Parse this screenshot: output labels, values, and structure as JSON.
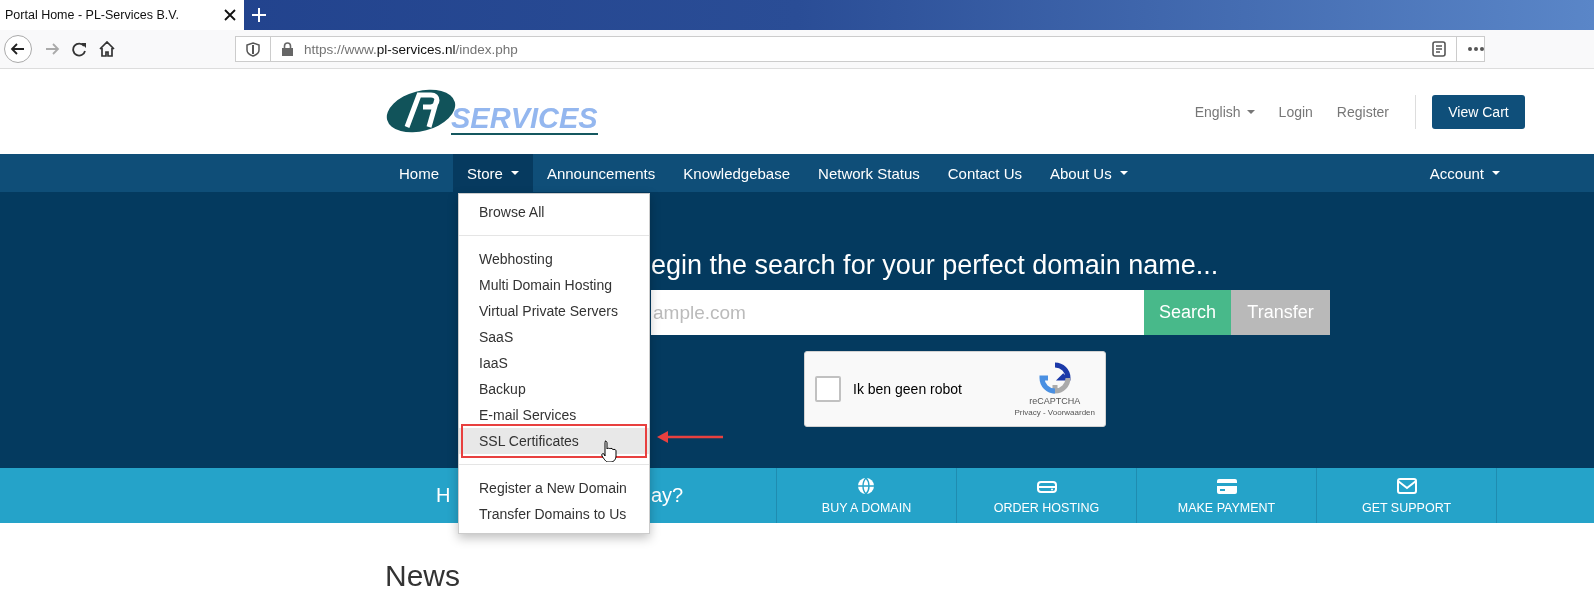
{
  "browser": {
    "tab_title": "Portal Home - PL-Services B.V.",
    "url": {
      "prefix": "https://www.",
      "domain": "pl-services.nl",
      "path": "/index.php"
    }
  },
  "header": {
    "logo_text": "SERVICES",
    "links": [
      {
        "label": "English",
        "dropdown": true
      },
      {
        "label": "Login",
        "dropdown": false
      },
      {
        "label": "Register",
        "dropdown": false
      }
    ],
    "cart_button": "View Cart"
  },
  "nav": {
    "items": [
      {
        "label": "Home",
        "selected": false,
        "dropdown": false
      },
      {
        "label": "Store",
        "selected": true,
        "dropdown": true
      },
      {
        "label": "Announcements",
        "selected": false,
        "dropdown": false
      },
      {
        "label": "Knowledgebase",
        "selected": false,
        "dropdown": false
      },
      {
        "label": "Network Status",
        "selected": false,
        "dropdown": false
      },
      {
        "label": "Contact Us",
        "selected": false,
        "dropdown": false
      },
      {
        "label": "About Us",
        "selected": false,
        "dropdown": true
      }
    ],
    "account": {
      "label": "Account",
      "dropdown": true
    }
  },
  "store_menu": {
    "sections": [
      {
        "items": [
          {
            "label": "Browse All",
            "selected": false,
            "highlighted": false
          }
        ]
      },
      {
        "items": [
          {
            "label": "Webhosting",
            "selected": false,
            "highlighted": false
          },
          {
            "label": "Multi Domain Hosting",
            "selected": false,
            "highlighted": false
          },
          {
            "label": "Virtual Private Servers",
            "selected": false,
            "highlighted": false
          },
          {
            "label": "SaaS",
            "selected": false,
            "highlighted": false
          },
          {
            "label": "IaaS",
            "selected": false,
            "highlighted": false
          },
          {
            "label": "Backup",
            "selected": false,
            "highlighted": false
          },
          {
            "label": "E-mail Services",
            "selected": false,
            "highlighted": false
          },
          {
            "label": "SSL Certificates",
            "selected": true,
            "highlighted": true
          }
        ]
      },
      {
        "items": [
          {
            "label": "Register a New Domain",
            "selected": false,
            "highlighted": false
          },
          {
            "label": "Transfer Domains to Us",
            "selected": false,
            "highlighted": false
          }
        ]
      }
    ]
  },
  "hero": {
    "heading": "egin the search for your perfect domain name...",
    "search": {
      "placeholder": "ample.com"
    },
    "buttons": [
      "Search",
      "Transfer"
    ],
    "captcha": {
      "checked": false,
      "label": "Ik ben geen robot",
      "brand": "reCAPTCHA",
      "links": "Privacy - Voorwaarden"
    }
  },
  "quick_bar": {
    "text_fragments": [
      "H",
      "ay?"
    ],
    "links": [
      "BUY A DOMAIN",
      "ORDER HOSTING",
      "MAKE PAYMENT",
      "GET SUPPORT"
    ]
  },
  "news": {
    "heading": "News"
  }
}
